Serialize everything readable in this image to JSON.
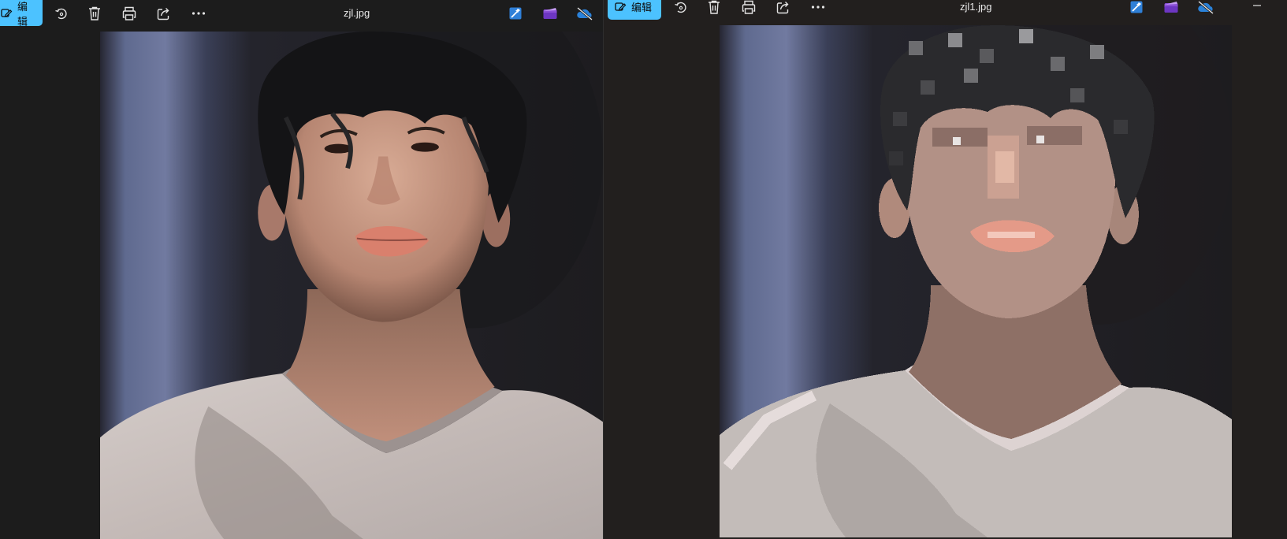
{
  "left_viewer": {
    "file_name": "zjl.jpg",
    "toolbar": {
      "edit_label": "编辑",
      "icons": [
        "edit-icon",
        "rotate-icon",
        "delete-icon",
        "print-icon",
        "share-icon",
        "more-icon",
        "enhance-icon",
        "video-editor-icon",
        "onedrive-icon"
      ]
    }
  },
  "right_viewer": {
    "file_name": "zjl1.jpg",
    "toolbar": {
      "edit_label": "编辑",
      "icons": [
        "edit-icon",
        "rotate-icon",
        "delete-icon",
        "print-icon",
        "share-icon",
        "more-icon",
        "enhance-icon",
        "video-editor-icon",
        "onedrive-icon"
      ]
    },
    "window_controls": [
      "minimize-icon"
    ]
  },
  "colors": {
    "accent": "#4cc2ff",
    "toolbar_bg": "#1c1c1c",
    "photo_bg_dark": "#1f1e22",
    "curtain_blue": "#6a7397",
    "shirt": "#c8bfbb",
    "skin": "#c79a85",
    "hair": "#141414"
  }
}
